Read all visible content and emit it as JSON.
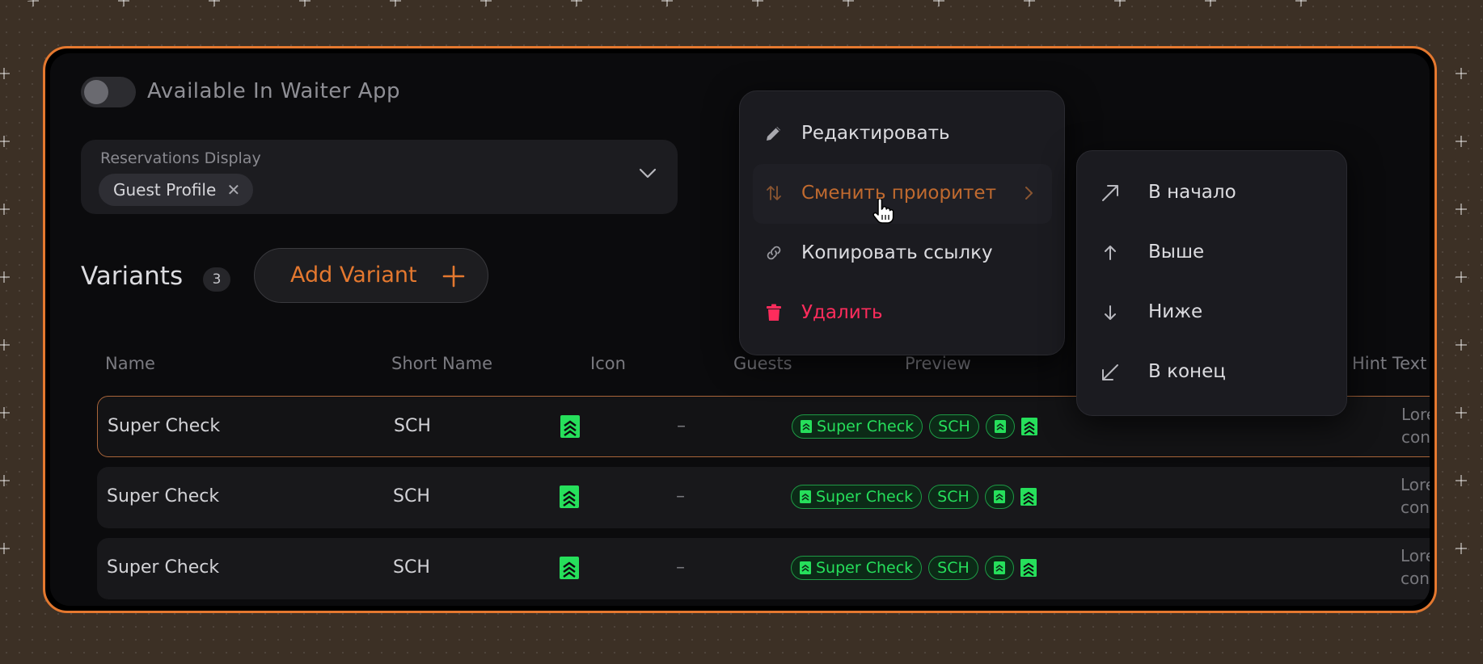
{
  "settings": {
    "toggle_label": "Available In Waiter App",
    "toggle_on": false
  },
  "reservations": {
    "label": "Reservations Display",
    "chip": "Guest Profile",
    "chip_remove": "✕"
  },
  "variants": {
    "title": "Variants",
    "count": "3",
    "add_button": "Add Variant"
  },
  "table": {
    "headers": [
      "Name",
      "Short Name",
      "Icon",
      "Guests",
      "Preview",
      "Hint Text"
    ],
    "rows": [
      {
        "name": "Super Check",
        "short": "SCH",
        "guests": "–",
        "preview_name": "Super Check",
        "preview_short": "SCH",
        "hint_line1": "Lorem ip",
        "hint_line2": "consecte",
        "icon": "check-badge-icon"
      },
      {
        "name": "Super Check",
        "short": "SCH",
        "guests": "–",
        "preview_name": "Super Check",
        "preview_short": "SCH",
        "hint_line1": "Lorem ip",
        "hint_line2": "consecte",
        "icon": "check-badge-icon"
      },
      {
        "name": "Super Check",
        "short": "SCH",
        "guests": "–",
        "preview_name": "Super Check",
        "preview_short": "SCH",
        "hint_line1": "Lorem ip",
        "hint_line2": "consecte",
        "icon": "check-badge-icon"
      }
    ]
  },
  "context_menu": {
    "items": [
      {
        "label": "Редактировать",
        "icon": "pencil-icon"
      },
      {
        "label": "Сменить приоритет",
        "icon": "swap-vertical-icon"
      },
      {
        "label": "Копировать ссылку",
        "icon": "link-icon"
      },
      {
        "label": "Удалить",
        "icon": "trash-icon"
      }
    ]
  },
  "priority_submenu": {
    "items": [
      {
        "label": "В начало",
        "icon": "arrow-up-right-icon"
      },
      {
        "label": "Выше",
        "icon": "arrow-up-icon"
      },
      {
        "label": "Ниже",
        "icon": "arrow-down-icon"
      },
      {
        "label": "В конец",
        "icon": "arrow-down-left-icon"
      }
    ]
  },
  "colors": {
    "accent": "#e4782f",
    "success": "#26df5b",
    "danger": "#ff2c5c",
    "panel_bg": "#0b0b0d",
    "menu_bg": "#1b1b20"
  }
}
